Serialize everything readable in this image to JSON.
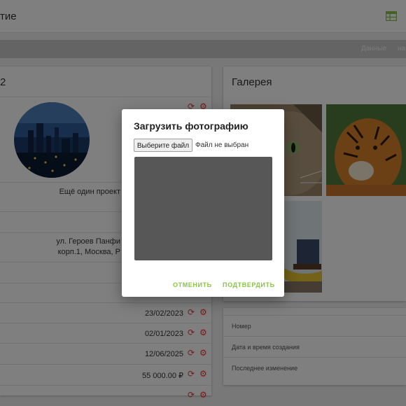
{
  "topbar": {
    "title": "тие",
    "table_icon": "table-view-icon"
  },
  "crumbs": [
    "Данные",
    "на"
  ],
  "left_card": {
    "title": "2",
    "project_text": "Ещё один проект",
    "address_line1": "ул. Героев Панфи",
    "address_line2": "корп.1, Москва, Р",
    "dates": [
      "23/02/2023",
      "02/01/2023",
      "12/06/2025"
    ],
    "price": "55 000.00 ₽"
  },
  "gallery": {
    "title": "Галерея",
    "images": [
      "cat",
      "tiger",
      "room"
    ]
  },
  "info": [
    "Номер",
    "Дата и время создания",
    "Последнее изменение"
  ],
  "modal": {
    "title": "Загрузить фотографию",
    "file_button": "Выберите файл",
    "file_status": "Файл не выбран",
    "cancel": "ОТМЕНИТЬ",
    "confirm": "ПОДТВЕРДИТЬ"
  },
  "colors": {
    "accent": "#8bc34a",
    "danger": "#e53935"
  }
}
